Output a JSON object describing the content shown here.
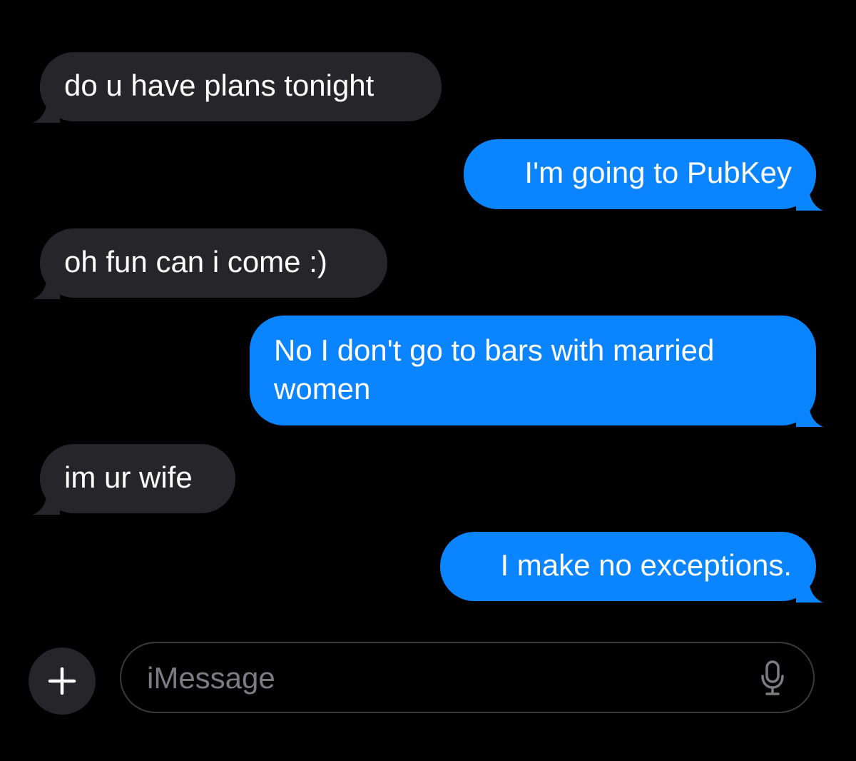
{
  "messages": [
    {
      "direction": "incoming",
      "text": "do u have plans tonight"
    },
    {
      "direction": "outgoing",
      "text": "I'm going to PubKey"
    },
    {
      "direction": "incoming",
      "text": "oh fun can i come :)"
    },
    {
      "direction": "outgoing",
      "text": "No I don't go to bars with married women"
    },
    {
      "direction": "incoming",
      "text": "im ur wife"
    },
    {
      "direction": "outgoing",
      "text": "I make no exceptions."
    }
  ],
  "composer": {
    "placeholder": "iMessage",
    "add_icon": "plus-icon",
    "mic_icon": "microphone-icon"
  },
  "colors": {
    "background": "#000000",
    "incoming_bubble": "#26252a",
    "outgoing_bubble": "#0a84ff",
    "text": "#ffffff",
    "placeholder": "#7c7c82"
  }
}
